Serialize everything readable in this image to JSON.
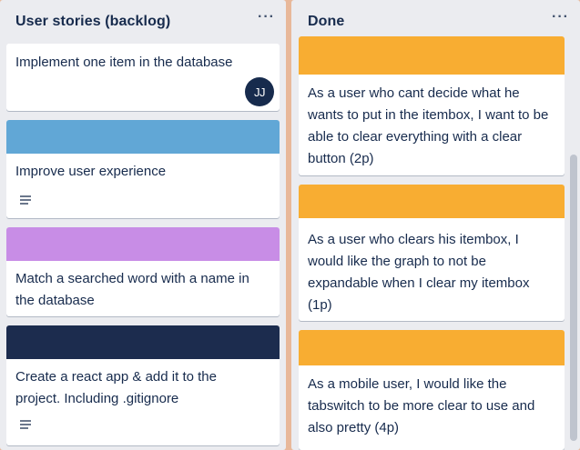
{
  "lists": [
    {
      "title": "User stories (backlog)",
      "menu": "···",
      "cards": [
        {
          "text": "Implement one item in the database",
          "avatar": "JJ"
        },
        {
          "cover": "#61a7d6",
          "text": "Improve user experience",
          "has_description": true
        },
        {
          "cover": "#c88de6",
          "text": "Match a searched word with a name in the database"
        },
        {
          "cover": "#1c2c4e",
          "text": "Create a react app & add it to the project. Including .gitignore",
          "has_description": true
        }
      ]
    },
    {
      "title": "Done",
      "menu": "···",
      "cards": [
        {
          "cover": "#f8ad32",
          "text": "As a user who cant decide what he wants to put in the itembox, I want to be able to clear everything with a clear button (2p)"
        },
        {
          "cover": "#f8ad32",
          "text": "As a user who clears his itembox, I would like the graph to not be expandable when I clear my itembox (1p)"
        },
        {
          "cover": "#f8ad32",
          "text": "As a mobile user, I would like the tabswitch to be more clear to use and also pretty (4p)"
        }
      ]
    }
  ],
  "icons": {
    "menu": "ellipsis-icon",
    "description": "description-lines-icon"
  },
  "colors": {
    "board_background": "#e8b89a",
    "list_background": "#ebecf0",
    "text": "#172b4d"
  }
}
